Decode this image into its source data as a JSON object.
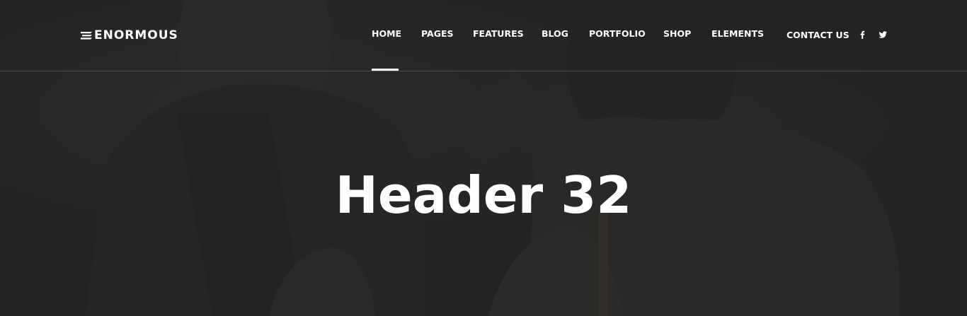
{
  "brand": {
    "name": "ENORMOUS",
    "icon": "menu-lines-logo-icon"
  },
  "nav": {
    "items": [
      {
        "label": "HOME",
        "active": true
      },
      {
        "label": "PAGES",
        "active": false
      },
      {
        "label": "FEATURES",
        "active": false
      },
      {
        "label": "BLOG",
        "active": false
      },
      {
        "label": "PORTFOLIO",
        "active": false
      },
      {
        "label": "SHOP",
        "active": false
      },
      {
        "label": "ELEMENTS",
        "active": false
      }
    ],
    "contact_label": "CONTACT US",
    "social": [
      {
        "icon": "facebook-icon"
      },
      {
        "icon": "twitter-icon"
      }
    ]
  },
  "hero": {
    "title": "Header 32",
    "background_image": "two-men-talking-photo-dark-overlay"
  },
  "colors": {
    "text": "#ffffff",
    "overlay": "#232323",
    "divider": "#5a5a5a"
  }
}
